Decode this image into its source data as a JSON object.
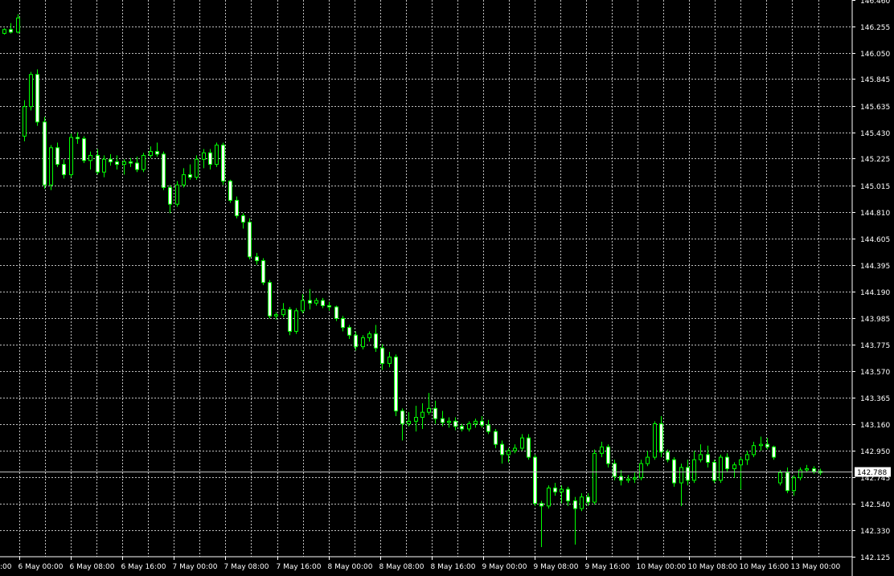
{
  "chart_data": {
    "type": "candlestick",
    "title": "",
    "xlabel": "",
    "ylabel": "",
    "ylim": [
      142.125,
      146.46
    ],
    "grid": true,
    "y_ticks": [
      "146.255",
      "146.050",
      "145.845",
      "145.635",
      "145.430",
      "145.225",
      "145.015",
      "144.810",
      "144.605",
      "144.395",
      "144.190",
      "143.985",
      "143.775",
      "143.570",
      "143.365",
      "143.160",
      "142.950",
      "142.745",
      "142.540",
      "142.330",
      "142.125"
    ],
    "y_top_partial": "146.460",
    "x_ticks": [
      "6 May 00:00",
      "6 May 08:00",
      "6 May 16:00",
      "7 May 00:00",
      "7 May 08:00",
      "7 May 16:00",
      "8 May 00:00",
      "8 May 08:00",
      "8 May 16:00",
      "9 May 00:00",
      "9 May 08:00",
      "9 May 16:00",
      "10 May 00:00",
      "10 May 08:00",
      "10 May 16:00",
      "13 May 00:00"
    ],
    "x_left_partial": ":00",
    "current_price": 142.788,
    "current_price_label": "142.788",
    "colors": {
      "background": "#000000",
      "grid": "#c0c0c0",
      "bull_body": "#000000",
      "bear_body": "#ffffff",
      "wick": "#00ff00",
      "price_line": "#c0c0c0"
    },
    "candles": [
      [
        146.2,
        146.24,
        146.19,
        146.23
      ],
      [
        146.23,
        146.28,
        146.2,
        146.21
      ],
      [
        146.21,
        146.35,
        146.2,
        146.32
      ],
      [
        145.4,
        145.68,
        145.36,
        145.63
      ],
      [
        145.63,
        145.9,
        145.6,
        145.88
      ],
      [
        145.88,
        145.92,
        145.48,
        145.51
      ],
      [
        145.51,
        145.55,
        144.99,
        145.02
      ],
      [
        145.02,
        145.33,
        144.98,
        145.31
      ],
      [
        145.31,
        145.35,
        145.16,
        145.18
      ],
      [
        145.18,
        145.22,
        145.07,
        145.1
      ],
      [
        145.1,
        145.42,
        145.08,
        145.39
      ],
      [
        145.39,
        145.43,
        145.34,
        145.38
      ],
      [
        145.38,
        145.4,
        145.19,
        145.21
      ],
      [
        145.21,
        145.28,
        145.14,
        145.25
      ],
      [
        145.25,
        145.3,
        145.1,
        145.12
      ],
      [
        145.12,
        145.25,
        145.08,
        145.22
      ],
      [
        145.22,
        145.26,
        145.17,
        145.2
      ],
      [
        145.2,
        145.25,
        145.14,
        145.18
      ],
      [
        145.18,
        145.22,
        145.1,
        145.2
      ],
      [
        145.2,
        145.23,
        145.16,
        145.19
      ],
      [
        145.19,
        145.24,
        145.12,
        145.14
      ],
      [
        145.14,
        145.27,
        145.12,
        145.25
      ],
      [
        145.25,
        145.32,
        145.23,
        145.28
      ],
      [
        145.28,
        145.35,
        145.24,
        145.26
      ],
      [
        145.26,
        145.28,
        144.98,
        145.0
      ],
      [
        145.0,
        145.02,
        144.8,
        144.87
      ],
      [
        144.87,
        145.05,
        144.85,
        145.02
      ],
      [
        145.02,
        145.15,
        145.0,
        145.1
      ],
      [
        145.1,
        145.18,
        145.06,
        145.08
      ],
      [
        145.08,
        145.25,
        145.06,
        145.22
      ],
      [
        145.22,
        145.3,
        145.15,
        145.27
      ],
      [
        145.27,
        145.3,
        145.14,
        145.18
      ],
      [
        145.18,
        145.35,
        145.16,
        145.33
      ],
      [
        145.33,
        145.35,
        145.02,
        145.05
      ],
      [
        145.05,
        145.06,
        144.88,
        144.9
      ],
      [
        144.9,
        144.93,
        144.76,
        144.78
      ],
      [
        144.78,
        144.8,
        144.68,
        144.73
      ],
      [
        144.73,
        144.76,
        144.44,
        144.46
      ],
      [
        144.46,
        144.49,
        144.4,
        144.43
      ],
      [
        144.43,
        144.45,
        144.24,
        144.26
      ],
      [
        144.26,
        144.28,
        143.98,
        144.0
      ],
      [
        144.0,
        144.03,
        143.97,
        144.01
      ],
      [
        144.01,
        144.1,
        143.99,
        144.05
      ],
      [
        144.05,
        144.07,
        143.85,
        143.88
      ],
      [
        143.88,
        144.06,
        143.86,
        144.04
      ],
      [
        144.04,
        144.17,
        144.02,
        144.12
      ],
      [
        144.12,
        144.21,
        144.05,
        144.1
      ],
      [
        144.1,
        144.14,
        144.08,
        144.12
      ],
      [
        144.12,
        144.14,
        144.06,
        144.08
      ],
      [
        144.08,
        144.11,
        144.04,
        144.07
      ],
      [
        144.07,
        144.08,
        143.96,
        143.98
      ],
      [
        143.98,
        144.0,
        143.88,
        143.91
      ],
      [
        143.91,
        143.93,
        143.82,
        143.85
      ],
      [
        143.85,
        143.88,
        143.73,
        143.76
      ],
      [
        143.76,
        143.85,
        143.74,
        143.83
      ],
      [
        143.83,
        143.88,
        143.8,
        143.86
      ],
      [
        143.86,
        143.93,
        143.72,
        143.75
      ],
      [
        143.75,
        143.78,
        143.58,
        143.63
      ],
      [
        143.63,
        143.72,
        143.6,
        143.68
      ],
      [
        143.68,
        143.7,
        143.22,
        143.26
      ],
      [
        143.26,
        143.28,
        143.03,
        143.16
      ],
      [
        143.16,
        143.25,
        143.14,
        143.18
      ],
      [
        143.18,
        143.3,
        143.1,
        143.21
      ],
      [
        143.21,
        143.32,
        143.12,
        143.25
      ],
      [
        143.25,
        143.4,
        143.23,
        143.28
      ],
      [
        143.28,
        143.34,
        143.16,
        143.2
      ],
      [
        143.2,
        143.26,
        143.14,
        143.17
      ],
      [
        143.17,
        143.21,
        143.13,
        143.18
      ],
      [
        143.18,
        143.21,
        143.11,
        143.14
      ],
      [
        143.14,
        143.16,
        143.1,
        143.12
      ],
      [
        143.12,
        143.18,
        143.1,
        143.16
      ],
      [
        143.16,
        143.2,
        143.13,
        143.18
      ],
      [
        143.18,
        143.22,
        143.13,
        143.15
      ],
      [
        143.15,
        143.19,
        143.08,
        143.1
      ],
      [
        143.1,
        143.12,
        142.97,
        143.0
      ],
      [
        143.0,
        143.03,
        142.85,
        142.92
      ],
      [
        142.92,
        142.97,
        142.86,
        142.95
      ],
      [
        142.95,
        143.0,
        142.93,
        142.97
      ],
      [
        142.97,
        143.08,
        142.95,
        143.05
      ],
      [
        143.05,
        143.08,
        142.88,
        142.9
      ],
      [
        142.9,
        142.92,
        142.52,
        142.54
      ],
      [
        142.54,
        142.56,
        142.2,
        142.52
      ],
      [
        142.52,
        142.68,
        142.5,
        142.66
      ],
      [
        142.66,
        142.7,
        142.6,
        142.63
      ],
      [
        142.63,
        142.68,
        142.54,
        142.65
      ],
      [
        142.65,
        142.67,
        142.52,
        142.56
      ],
      [
        142.56,
        142.59,
        142.22,
        142.5
      ],
      [
        142.5,
        142.62,
        142.48,
        142.59
      ],
      [
        142.59,
        142.62,
        142.52,
        142.55
      ],
      [
        142.55,
        142.96,
        142.53,
        142.93
      ],
      [
        142.93,
        143.02,
        142.9,
        142.98
      ],
      [
        142.98,
        143.0,
        142.82,
        142.85
      ],
      [
        142.85,
        142.88,
        142.72,
        142.75
      ],
      [
        142.75,
        142.8,
        142.68,
        142.72
      ],
      [
        142.72,
        142.76,
        142.7,
        142.73
      ],
      [
        142.73,
        142.78,
        142.7,
        142.74
      ],
      [
        142.74,
        142.88,
        142.72,
        142.85
      ],
      [
        142.85,
        142.95,
        142.83,
        142.9
      ],
      [
        142.9,
        143.18,
        142.88,
        143.16
      ],
      [
        143.16,
        143.22,
        142.9,
        142.94
      ],
      [
        142.94,
        142.96,
        142.86,
        142.88
      ],
      [
        142.88,
        142.9,
        142.67,
        142.7
      ],
      [
        142.7,
        142.85,
        142.52,
        142.82
      ],
      [
        142.82,
        142.88,
        142.68,
        142.72
      ],
      [
        142.72,
        142.95,
        142.7,
        142.88
      ],
      [
        142.88,
        143.0,
        142.86,
        142.92
      ],
      [
        142.92,
        142.99,
        142.82,
        142.86
      ],
      [
        142.86,
        142.88,
        142.7,
        142.72
      ],
      [
        142.72,
        142.92,
        142.7,
        142.9
      ],
      [
        142.9,
        142.93,
        142.78,
        142.81
      ],
      [
        142.81,
        142.86,
        142.74,
        142.84
      ],
      [
        142.84,
        142.9,
        142.65,
        142.88
      ],
      [
        142.88,
        142.95,
        142.84,
        142.92
      ],
      [
        142.92,
        143.02,
        142.9,
        142.99
      ],
      [
        142.99,
        143.06,
        142.95,
        143.0
      ],
      [
        143.0,
        143.05,
        142.96,
        142.98
      ],
      [
        142.98,
        142.99,
        142.88,
        142.9
      ],
      [
        142.7,
        142.8,
        142.68,
        142.78
      ],
      [
        142.78,
        142.82,
        142.62,
        142.64
      ],
      [
        142.64,
        142.76,
        142.6,
        142.74
      ],
      [
        142.74,
        142.82,
        142.72,
        142.8
      ],
      [
        142.8,
        142.84,
        142.78,
        142.81
      ],
      [
        142.81,
        142.83,
        142.77,
        142.79
      ],
      [
        142.79,
        142.81,
        142.76,
        142.78
      ]
    ]
  }
}
